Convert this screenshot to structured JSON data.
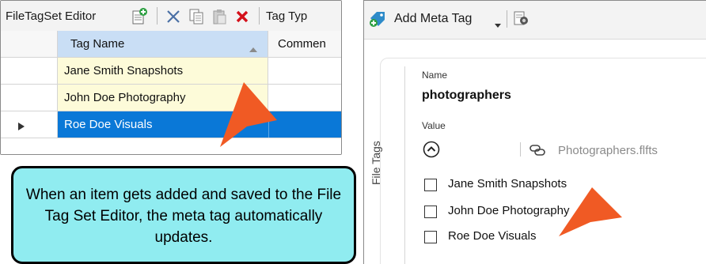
{
  "editor": {
    "title": "FileTagSet Editor",
    "toolbar_label_truncated": "Tag Typ",
    "columns": [
      "Tag Name",
      "Commen"
    ],
    "rows": [
      {
        "tag_name": "Jane Smith Snapshots",
        "selected": false
      },
      {
        "tag_name": "John Doe Photography",
        "selected": false
      },
      {
        "tag_name": "Roe Doe Visuals",
        "selected": true
      }
    ],
    "icons": [
      "new-tag-icon",
      "cut-icon",
      "copy-icon",
      "paste-icon",
      "delete-icon",
      "sort-asc-icon",
      "row-pointer-icon"
    ]
  },
  "meta": {
    "add_button": "Add Meta Tag",
    "side_label": "File Tags",
    "name_label": "Name",
    "name_value": "photographers",
    "value_label": "Value",
    "link_file": "Photographers.flfts",
    "options": [
      {
        "label": "Jane Smith Snapshots",
        "checked": false
      },
      {
        "label": "John Doe Photography",
        "checked": false
      },
      {
        "label": "Roe Doe Visuals",
        "checked": false
      }
    ],
    "icons": [
      "add-meta-tag-icon",
      "dropdown-arrow-icon",
      "preview-icon",
      "collapse-icon",
      "link-icon"
    ]
  },
  "callout": {
    "text": "When an item gets added and saved to the File Tag Set Editor, the meta tag automatically updates."
  },
  "colors": {
    "row_highlight": "#fdfbd9",
    "row_selected": "#0a78d7",
    "header_blue": "#c9def5",
    "callout_bg": "#90ecf0",
    "arrow_orange": "#f05a24"
  }
}
